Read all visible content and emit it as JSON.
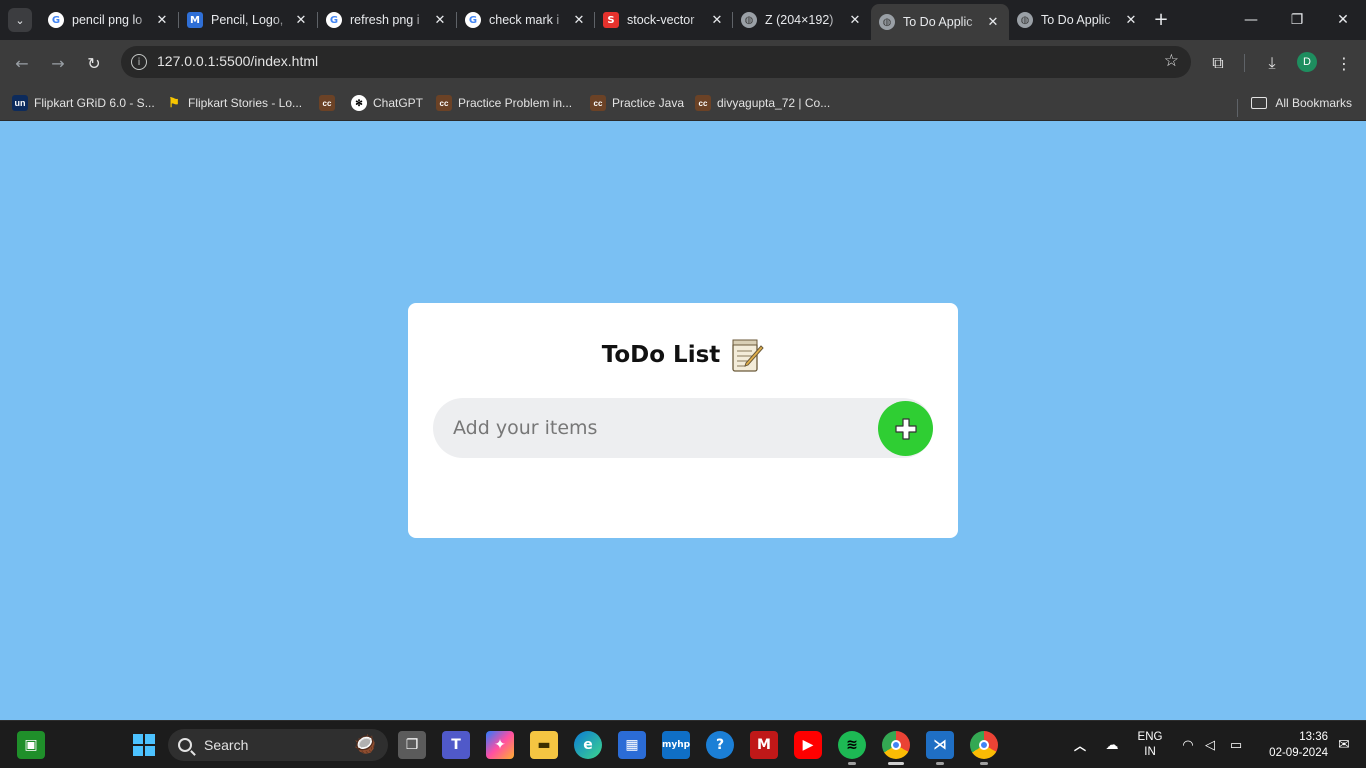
{
  "browser": {
    "tabs": [
      {
        "title": "pencil png lo",
        "favicon": "google-icon"
      },
      {
        "title": "Pencil, Logo,",
        "favicon": "pencil-site-icon"
      },
      {
        "title": "refresh png i",
        "favicon": "google-icon"
      },
      {
        "title": "check mark i",
        "favicon": "google-icon"
      },
      {
        "title": "stock-vector",
        "favicon": "red-site-icon"
      },
      {
        "title": "Z (204×192)",
        "favicon": "globe-icon"
      },
      {
        "title": "To Do Applic",
        "favicon": "globe-icon",
        "active": true
      },
      {
        "title": "To Do Applic",
        "favicon": "globe-icon"
      }
    ],
    "url": "127.0.0.1:5500/index.html",
    "profile_initial": "D",
    "bookmarks": [
      {
        "label": "Flipkart GRiD 6.0 - S...",
        "icon": "unstop-icon"
      },
      {
        "label": "Flipkart Stories - Lo...",
        "icon": "flipkart-icon"
      },
      {
        "label": "",
        "icon": "codechef-icon"
      },
      {
        "label": "ChatGPT",
        "icon": "chatgpt-icon"
      },
      {
        "label": "Practice Problem in...",
        "icon": "codechef-icon"
      },
      {
        "label": "Practice Java",
        "icon": "codechef-icon"
      },
      {
        "label": "divyagupta_72 | Co...",
        "icon": "codechef-icon"
      }
    ],
    "all_bookmarks": "All Bookmarks"
  },
  "app": {
    "title": "ToDo List",
    "input_placeholder": "Add your items",
    "input_value": "",
    "accent": "#2fce33",
    "background": "#7ac0f3"
  },
  "taskbar": {
    "search_label": "Search",
    "lang_line1": "ENG",
    "lang_line2": "IN",
    "time": "13:36",
    "date": "02-09-2024"
  }
}
